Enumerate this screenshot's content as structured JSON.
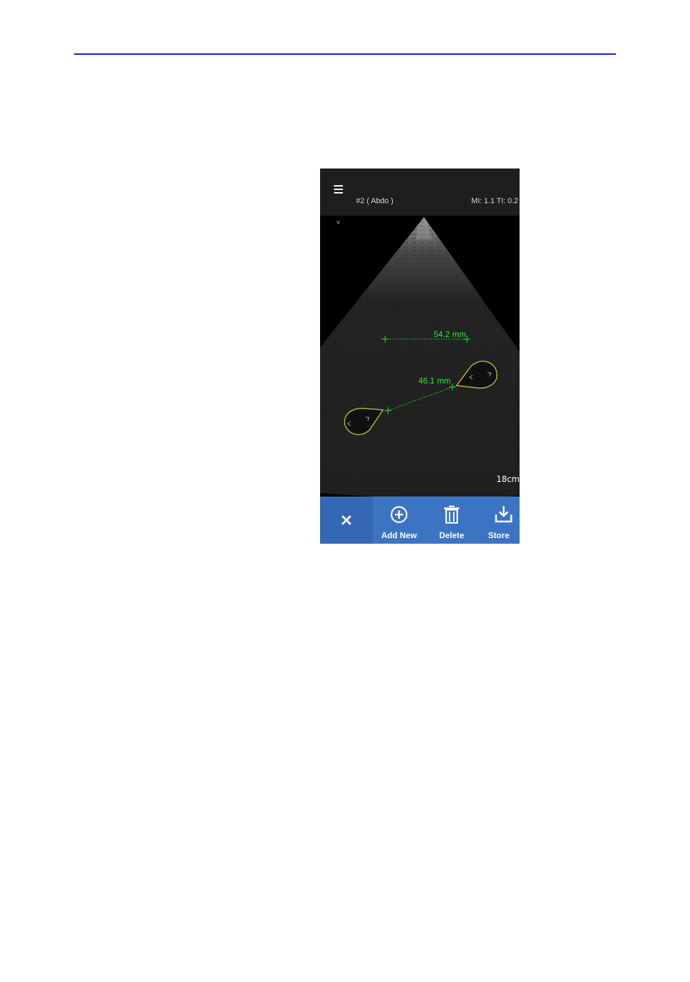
{
  "header": {
    "exam_label": "#2 ( Abdo )",
    "indices": "MI: 1.1  TI: 0.2"
  },
  "image": {
    "orientation_marker": "v",
    "depth": "18cm",
    "measurements": [
      {
        "label": "54.2 mm"
      },
      {
        "label": "46.1 mm"
      }
    ]
  },
  "toolbar": {
    "close_icon": "close-icon",
    "add_new_label": "Add New",
    "add_new_icon": "plus-circle-icon",
    "delete_label": "Delete",
    "delete_icon": "trash-icon",
    "store_label": "Store",
    "store_icon": "download-icon"
  },
  "colors": {
    "header_rule": "#1a1ad0",
    "toolbar": "#3c74c4",
    "measurement": "#2ee82e",
    "caliper_outline": "#b4b43a"
  }
}
